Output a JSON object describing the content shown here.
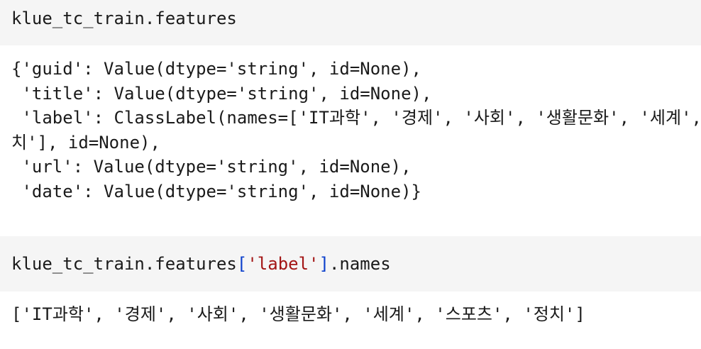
{
  "cells": [
    {
      "input": {
        "code": "klue_tc_train.features"
      },
      "output": {
        "lines": [
          "{'guid': Value(dtype='string', id=None),",
          " 'title': Value(dtype='string', id=None),",
          " 'label': ClassLabel(names=['IT과학', '경제', '사회', '생활문화', '세계', '스포츠', '정",
          "치'], id=None),",
          " 'url': Value(dtype='string', id=None),",
          " 'date': Value(dtype='string', id=None)}"
        ]
      }
    },
    {
      "input": {
        "code_prefix": "klue_tc_train.features",
        "bracket_open": "[",
        "string_literal": "'label'",
        "bracket_close": "]",
        "code_suffix": ".names"
      },
      "output": {
        "lines": [
          "['IT과학', '경제', '사회', '생활문화', '세계', '스포츠', '정치']"
        ]
      }
    }
  ]
}
